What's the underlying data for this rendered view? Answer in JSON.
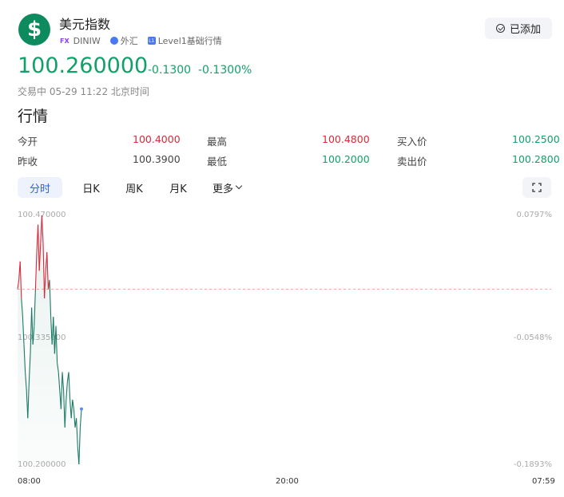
{
  "header": {
    "name": "美元指数",
    "code_badge": "FX",
    "code": "DINIW",
    "market": "外汇",
    "level_badge": "L1",
    "level": "Level1基础行情",
    "added_label": "已添加"
  },
  "quote": {
    "price": "100.260000",
    "change": "-0.1300",
    "change_pct": "-0.1300%",
    "status": "交易中 05-29 11:22 北京时间"
  },
  "section_title": "行情",
  "stats": {
    "open_label": "今开",
    "open_value": "100.4000",
    "high_label": "最高",
    "high_value": "100.4800",
    "bid_label": "买入价",
    "bid_value": "100.2500",
    "prev_label": "昨收",
    "prev_value": "100.3900",
    "low_label": "最低",
    "low_value": "100.2000",
    "ask_label": "卖出价",
    "ask_value": "100.2800"
  },
  "tabs": [
    {
      "label": "分时",
      "active": true
    },
    {
      "label": "日K",
      "active": false
    },
    {
      "label": "周K",
      "active": false
    },
    {
      "label": "月K",
      "active": false
    },
    {
      "label": "更多",
      "active": false
    }
  ],
  "colors": {
    "up": "#d8293a",
    "down": "#12a06a",
    "line": "#1a7a64",
    "accent": "#2f5ee8",
    "prev_close_line": "#f0a090"
  },
  "chart_data": {
    "type": "line",
    "y_labels_left": [
      "100.470000",
      "100.335000",
      "100.200000"
    ],
    "y_labels_right": [
      "0.0797%",
      "-0.0548%",
      "-0.1893%"
    ],
    "x_labels": [
      "08:00",
      "20:00",
      "07:59"
    ],
    "ylim": [
      100.2,
      100.47
    ],
    "prev_close": 100.39,
    "values": [
      100.39,
      100.4,
      100.42,
      100.38,
      100.36,
      100.33,
      100.3,
      100.28,
      100.25,
      100.29,
      100.32,
      100.37,
      100.33,
      100.35,
      100.39,
      100.43,
      100.46,
      100.41,
      100.44,
      100.47,
      100.44,
      100.38,
      100.41,
      100.43,
      100.39,
      100.4,
      100.36,
      100.33,
      100.36,
      100.32,
      100.35,
      100.31,
      100.3,
      100.28,
      100.26,
      100.3,
      100.28,
      100.24,
      100.27,
      100.29,
      100.3,
      100.27,
      100.25,
      100.27,
      100.26,
      100.24,
      100.25,
      100.22,
      100.2,
      100.24,
      100.26
    ]
  }
}
